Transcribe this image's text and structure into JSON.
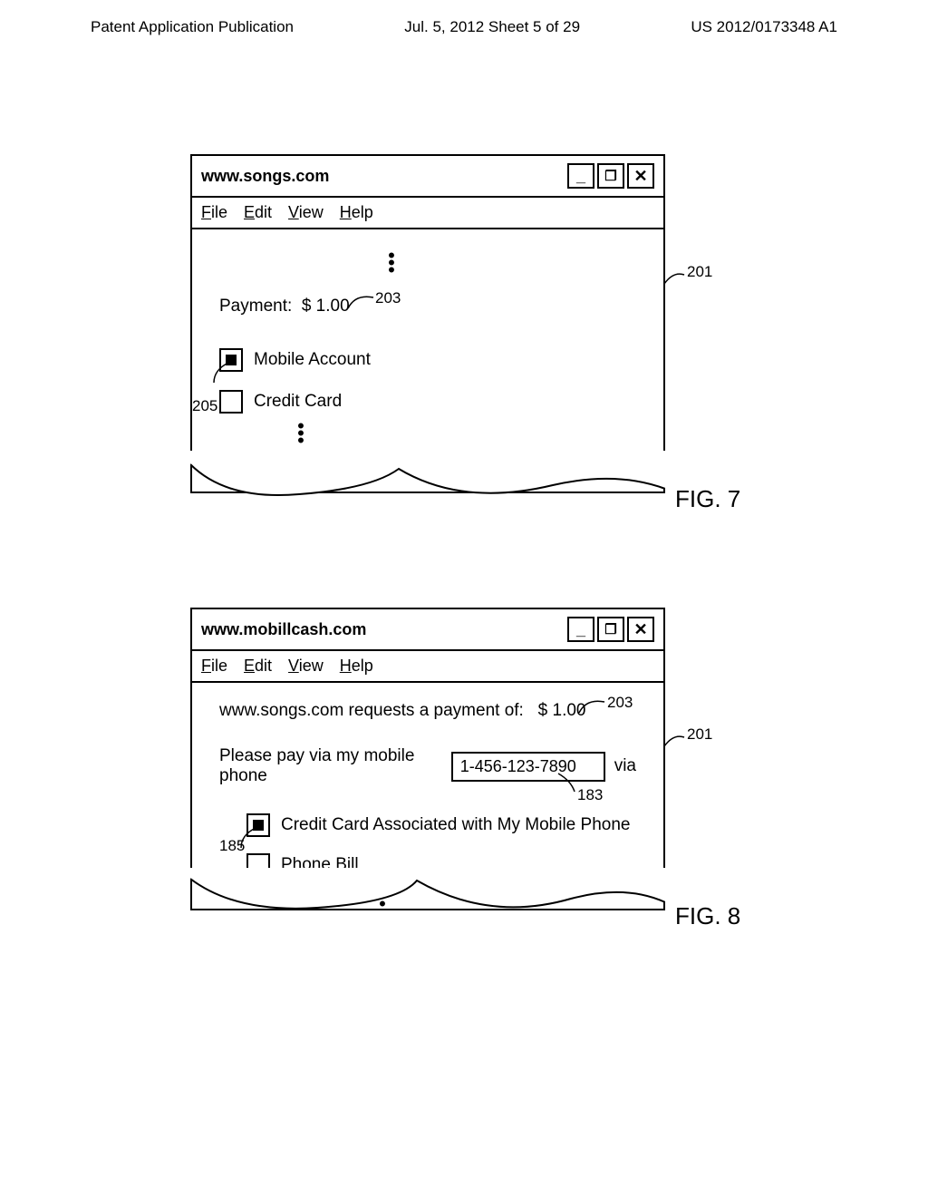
{
  "header": {
    "left": "Patent Application Publication",
    "center": "Jul. 5, 2012   Sheet 5 of 29",
    "right": "US 2012/0173348 A1"
  },
  "fig7": {
    "label": "FIG. 7",
    "window_title": "www.songs.com",
    "menus": {
      "file": "File",
      "edit": "Edit",
      "view": "View",
      "help": "Help"
    },
    "payment_label": "Payment:",
    "payment_amount": "$ 1.00",
    "option1": "Mobile Account",
    "option2": "Credit Card",
    "callout_201": "201",
    "callout_203": "203",
    "callout_205": "205"
  },
  "fig8": {
    "label": "FIG. 8",
    "window_title": "www.mobillcash.com",
    "menus": {
      "file": "File",
      "edit": "Edit",
      "view": "View",
      "help": "Help"
    },
    "req_text_pre": "www.songs.com requests a payment of:",
    "req_amount": "$ 1.00",
    "pay_text": "Please pay via my mobile phone",
    "phone_value": "1-456-123-7890",
    "via": "via",
    "option1": "Credit Card Associated with My Mobile Phone",
    "option2": "Phone Bill",
    "callout_201": "201",
    "callout_203": "203",
    "callout_183": "183",
    "callout_185": "185"
  }
}
